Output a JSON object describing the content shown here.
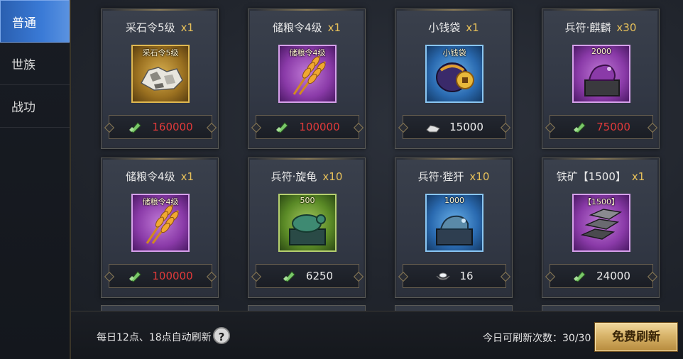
{
  "sidebar": {
    "tabs": [
      {
        "label": "普通",
        "active": true
      },
      {
        "label": "世族",
        "active": false
      },
      {
        "label": "战功",
        "active": false
      }
    ]
  },
  "shop": {
    "items": [
      {
        "name": "采石令5级",
        "qty": "x1",
        "icon_label": "采石令5级",
        "icon": "stone-ore-icon",
        "rarity": "gold",
        "price": "160000",
        "price_color": "#e03a3a",
        "currency_icon": "jade-token-icon"
      },
      {
        "name": "储粮令4级",
        "qty": "x1",
        "icon_label": "储粮令4级",
        "icon": "wheat-icon",
        "rarity": "purple",
        "price": "100000",
        "price_color": "#e03a3a",
        "currency_icon": "jade-token-icon"
      },
      {
        "name": "小钱袋",
        "qty": "x1",
        "icon_label": "小钱袋",
        "icon": "coin-pouch-icon",
        "rarity": "blue",
        "price": "15000",
        "price_color": "#ececec",
        "currency_icon": "silver-ore-icon"
      },
      {
        "name": "兵符·麒麟",
        "qty": "x30",
        "icon_label": "2000",
        "icon": "qilin-seal-icon",
        "rarity": "purple",
        "price": "75000",
        "price_color": "#e03a3a",
        "currency_icon": "jade-token-icon"
      },
      {
        "name": "储粮令4级",
        "qty": "x1",
        "icon_label": "储粮令4级",
        "icon": "wheat-icon",
        "rarity": "purple",
        "price": "100000",
        "price_color": "#e03a3a",
        "currency_icon": "jade-token-icon"
      },
      {
        "name": "兵符·旋龟",
        "qty": "x10",
        "icon_label": "500",
        "icon": "turtle-seal-icon",
        "rarity": "green",
        "price": "6250",
        "price_color": "#ececec",
        "currency_icon": "jade-token-icon"
      },
      {
        "name": "兵符·狴犴",
        "qty": "x10",
        "icon_label": "1000",
        "icon": "bian-seal-icon",
        "rarity": "blue",
        "price": "16",
        "price_color": "#ececec",
        "currency_icon": "silver-ingot-icon"
      },
      {
        "name": "铁矿【1500】",
        "qty": "x1",
        "icon_label": "【1500】",
        "icon": "iron-ingot-icon",
        "rarity": "purple",
        "price": "24000",
        "price_color": "#ececec",
        "currency_icon": "jade-token-icon"
      }
    ]
  },
  "footer": {
    "refresh_note": "每日12点、18点自动刷新",
    "help_label": "?",
    "refresh_count": "今日可刷新次数：30/30",
    "free_refresh_label": "免费刷新"
  }
}
